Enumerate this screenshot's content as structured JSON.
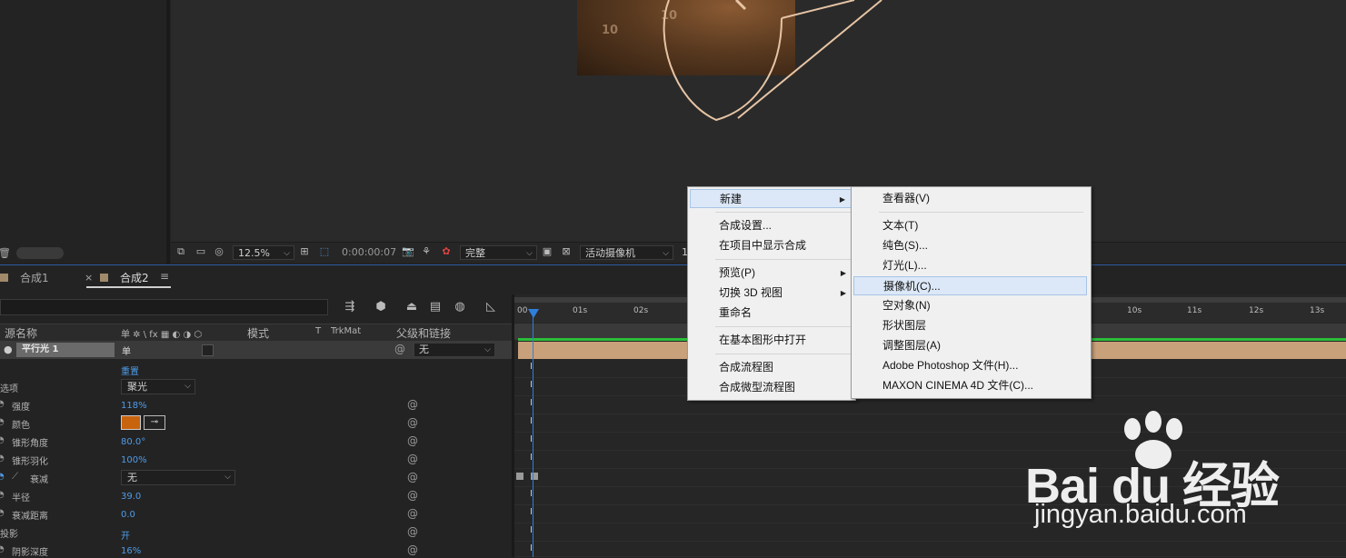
{
  "viewer_toolbar": {
    "zoom": "12.5%",
    "timecode": "0:00:00:07",
    "resolution": "完整",
    "camera": "活动摄像机",
    "views_partial": "1"
  },
  "tabs": [
    {
      "label": "合成1"
    },
    {
      "label": "合成2"
    }
  ],
  "tab_close": "×",
  "tab_menu": "≡",
  "layer_headers": {
    "source_name": "源名称",
    "switches": "单 ✲ \\ fx ▦ ◐ ◑ ⬡",
    "mode": "模式",
    "t": "T",
    "trkmat": "TrkMat",
    "parent": "父级和链接"
  },
  "layer": {
    "name": "平行光 1",
    "switch": "单",
    "parent_value": "无"
  },
  "properties": [
    {
      "label": "",
      "value": "重置",
      "type": "link"
    },
    {
      "label": "选项",
      "value": "聚光",
      "type": "select"
    },
    {
      "label": "强度",
      "value": "118%",
      "type": "value"
    },
    {
      "label": "颜色",
      "value": "",
      "type": "color"
    },
    {
      "label": "锥形角度",
      "value": "80.0°",
      "type": "value"
    },
    {
      "label": "锥形羽化",
      "value": "100%",
      "type": "value"
    },
    {
      "label": "衰减",
      "value": "无",
      "type": "select"
    },
    {
      "label": "半径",
      "value": "39.0",
      "type": "value"
    },
    {
      "label": "衰减距离",
      "value": "0.0",
      "type": "value"
    },
    {
      "label": "投影",
      "value": "开",
      "type": "link"
    },
    {
      "label": "阴影深度",
      "value": "16%",
      "type": "value"
    }
  ],
  "color_swatch": "#c8640e",
  "ruler_ticks": [
    "00",
    "01s",
    "02s",
    "10s",
    "11s",
    "12s",
    "13s"
  ],
  "menu_main": {
    "items": [
      {
        "label": "新建",
        "submenu": true
      },
      {
        "label": "合成设置...",
        "submenu": false
      },
      {
        "label": "在项目中显示合成",
        "submenu": false
      },
      {
        "label": "预览(P)",
        "submenu": true
      },
      {
        "label": "切换 3D 视图",
        "submenu": true
      },
      {
        "label": "重命名",
        "submenu": false
      },
      {
        "label": "在基本图形中打开",
        "submenu": false
      },
      {
        "label": "合成流程图",
        "submenu": false
      },
      {
        "label": "合成微型流程图",
        "submenu": false
      }
    ]
  },
  "menu_sub": {
    "items": [
      {
        "label": "查看器(V)"
      },
      {
        "label": "文本(T)"
      },
      {
        "label": "纯色(S)..."
      },
      {
        "label": "灯光(L)..."
      },
      {
        "label": "摄像机(C)..."
      },
      {
        "label": "空对象(N)"
      },
      {
        "label": "形状图层"
      },
      {
        "label": "调整图层(A)"
      },
      {
        "label": "Adobe Photoshop 文件(H)..."
      },
      {
        "label": "MAXON CINEMA 4D 文件(C)..."
      }
    ]
  },
  "watermark": {
    "brand": "Bai du 经验",
    "url": "jingyan.baidu.com"
  },
  "colors": {
    "accent_blue": "#2f7fdc",
    "layer_bar": "#c8a07a",
    "green_bar": "#2bbf3a"
  }
}
